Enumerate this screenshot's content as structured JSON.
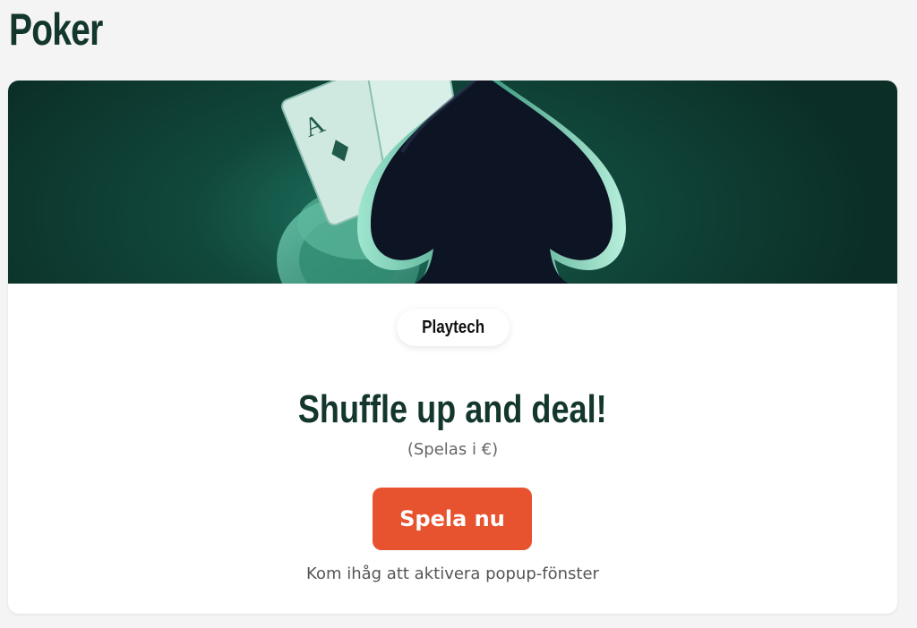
{
  "page": {
    "title": "Poker"
  },
  "card": {
    "provider": "Playtech",
    "headline": "Shuffle up and deal!",
    "subline": "(Spelas i €)",
    "play_button_label": "Spela nu",
    "popup_note": "Kom ihåg att aktivera popup-fönster"
  },
  "colors": {
    "title": "#13362d",
    "banner_dark": "#0b2f27",
    "banner_glow": "#1f7a65",
    "button": "#e8532f",
    "spade": "#0d1424"
  },
  "icons": {
    "banner_art": "spade-with-ace-card-and-chips"
  }
}
